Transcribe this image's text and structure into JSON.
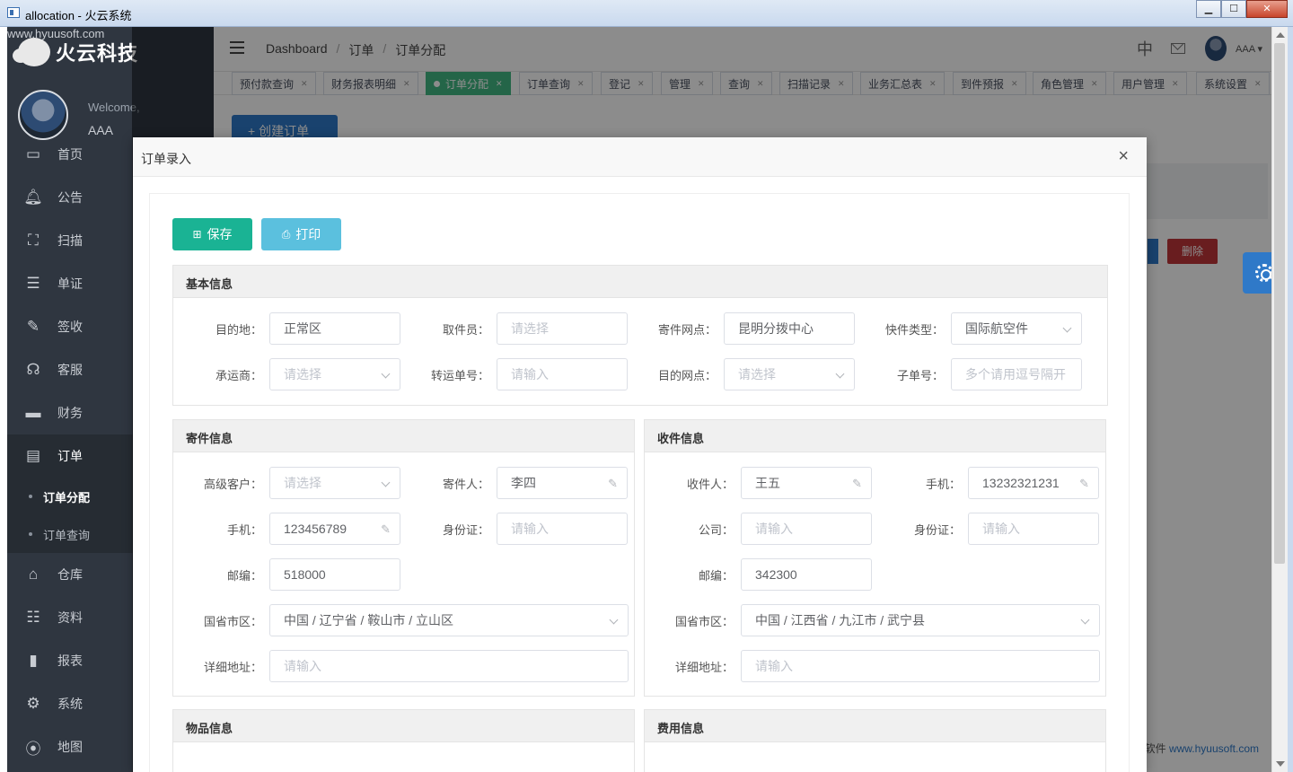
{
  "window": {
    "title": "allocation - 火云系统"
  },
  "sidebar": {
    "logo_text": "火云科技",
    "logo_sub": "www.hyuusoft.com",
    "welcome": "Welcome,",
    "user": "AAA",
    "menu": [
      {
        "label": "首页",
        "icon": "monitor-icon"
      },
      {
        "label": "公告",
        "icon": "bell-icon"
      },
      {
        "label": "扫描",
        "icon": "scan-icon"
      },
      {
        "label": "单证",
        "icon": "document-icon"
      },
      {
        "label": "签收",
        "icon": "sign-icon"
      },
      {
        "label": "客服",
        "icon": "headset-icon"
      },
      {
        "label": "财务",
        "icon": "wallet-icon"
      },
      {
        "label": "订单",
        "icon": "clipboard-icon"
      }
    ],
    "submenu": [
      "订单分配",
      "订单查询"
    ],
    "menu2": [
      {
        "label": "仓库",
        "icon": "home-icon"
      },
      {
        "label": "资料",
        "icon": "sliders-icon"
      },
      {
        "label": "报表",
        "icon": "bar-chart-icon"
      },
      {
        "label": "系统",
        "icon": "gear-icon"
      },
      {
        "label": "地图",
        "icon": "map-pin-icon"
      }
    ]
  },
  "header": {
    "breadcrumb": [
      "Dashboard",
      "订单",
      "订单分配"
    ],
    "lang": "中",
    "user": "AAA ▾"
  },
  "tabs": [
    {
      "label": "预付款查询"
    },
    {
      "label": "财务报表明细"
    },
    {
      "label": "订单分配",
      "active": true
    },
    {
      "label": "订单查询"
    },
    {
      "label": "登记"
    },
    {
      "label": "管理"
    },
    {
      "label": "查询"
    },
    {
      "label": "扫描记录"
    },
    {
      "label": "业务汇总表"
    },
    {
      "label": "到件预报"
    },
    {
      "label": "角色管理"
    },
    {
      "label": "用户管理"
    },
    {
      "label": "系统设置"
    }
  ],
  "background": {
    "create_button": "+ 创建订单",
    "delete_button": "删除",
    "footer_prefix": "软件 ",
    "footer_link": "www.hyuusoft.com"
  },
  "dialog": {
    "title": "订单录入",
    "close": "×",
    "save_label": "保存",
    "print_label": "打印",
    "basic": {
      "title": "基本信息",
      "dest_label": "目的地：",
      "dest_value": "正常区",
      "picker_label": "取件员：",
      "picker_placeholder": "请选择",
      "send_site_label": "寄件网点：",
      "send_site_value": "昆明分拨中心",
      "express_type_label": "快件类型：",
      "express_type_value": "国际航空件",
      "carrier_label": "承运商：",
      "carrier_placeholder": "请选择",
      "transfer_no_label": "转运单号：",
      "transfer_no_placeholder": "请输入",
      "dest_site_label": "目的网点：",
      "dest_site_placeholder": "请选择",
      "sub_no_label": "子单号：",
      "sub_no_placeholder": "多个请用逗号隔开"
    },
    "sender": {
      "title": "寄件信息",
      "vip_label": "高级客户：",
      "vip_placeholder": "请选择",
      "name_label": "寄件人：",
      "name_value": "李四",
      "phone_label": "手机：",
      "phone_value": "123456789",
      "id_label": "身份证：",
      "id_placeholder": "请输入",
      "zip_label": "邮编：",
      "zip_value": "518000",
      "region_label": "国省市区：",
      "region_value": "中国 / 辽宁省 / 鞍山市 / 立山区",
      "addr_label": "详细地址：",
      "addr_placeholder": "请输入"
    },
    "receiver": {
      "title": "收件信息",
      "name_label": "收件人：",
      "name_value": "王五",
      "phone_label": "手机：",
      "phone_value": "13232321231",
      "company_label": "公司：",
      "company_placeholder": "请输入",
      "id_label": "身份证：",
      "id_placeholder": "请输入",
      "zip_label": "邮编：",
      "zip_value": "342300",
      "region_label": "国省市区：",
      "region_value": "中国 / 江西省 / 九江市 / 武宁县",
      "addr_label": "详细地址：",
      "addr_placeholder": "请输入"
    },
    "goods": {
      "title": "物品信息"
    },
    "fee": {
      "title": "费用信息"
    }
  },
  "colors": {
    "accent": "#1ab394",
    "info": "#5bc0de",
    "sidebar": "#2f3640",
    "primary": "#2f79c8",
    "danger": "#c03639"
  }
}
